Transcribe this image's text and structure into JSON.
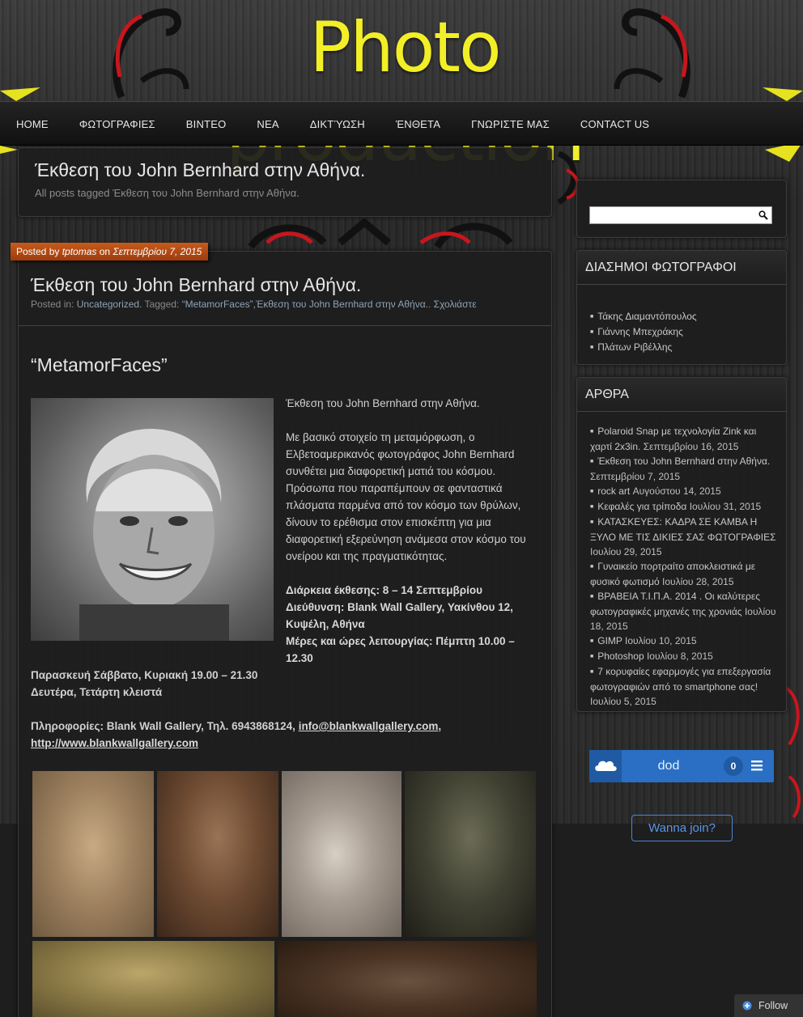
{
  "header": {
    "title": "Photo production"
  },
  "nav": {
    "items": [
      "HOME",
      "ΦΩΤΟΓΡΑΦΙΕΣ",
      "ΒΙΝΤΕΟ",
      "ΝΕΑ",
      "ΔΙΚΤΎΩΣΗ",
      "ΈΝΘΕΤΑ",
      "ΓΝΩΡΙΣΤΕ ΜΑΣ",
      "CONTACT US"
    ]
  },
  "archive": {
    "title": "Έκθεση του John Bernhard στην Αθήνα.",
    "description": "All posts tagged Έκθεση του John Bernhard στην Αθήνα."
  },
  "post": {
    "date_tag": {
      "prefix": "Posted by",
      "author": "tptomas",
      "on": "on",
      "date": "Σεπτεμβρίου 7, 2015"
    },
    "title": "Έκθεση του John Bernhard στην Αθήνα.",
    "meta": {
      "posted_in": "Posted in:",
      "category": "Uncategorized",
      "tagged": ". Tagged:",
      "tags": "“MetamorFaces”,Έκθεση του John Bernhard στην Αθήνα.",
      "sep": ".",
      "comment": "Σχολιάστε"
    },
    "heading": "“MetamorFaces”",
    "paragraphs": [
      "Έκθεση του John Bernhard στην Αθήνα.",
      "Με βασικό στοιχείο τη μεταμόρφωση, ο Ελβετοαμερικανός φωτογράφος John Bernhard συνθέτει μια διαφορετική ματιά του κόσμου. Πρόσωπα που παραπέμπουν σε φανταστικά πλάσματα παρμένα από τον κόσμο των θρύλων, δίνουν το ερέθισμα στον επισκέπτη για μια διαφορετική εξερεύνηση ανάμεσα στον κόσμο του ονείρου και της πραγματικότητας."
    ],
    "details": {
      "duration": "Διάρκεια έκθεσης: 8 – 14 Σεπτεμβρίου",
      "address": "Διεύθυνση: Blank Wall Gallery, Υακίνθου 12, Κυψέλη, Αθήνα",
      "hours": "Μέρες και ώρες λειτουργίας: Πέμπτη 10.00 – 12.30",
      "hours2": "Παρασκευή Σάββατο, Κυριακή 19.00 – 21.30",
      "closed": "Δευτέρα, Τετάρτη κλειστά",
      "info_prefix": "Πληροφορίες: Blank Wall Gallery, Τηλ. 6943868124,",
      "email": "info@blankwallgallery.com",
      "comma": ",",
      "url": "http://www.blankwallgallery.com"
    }
  },
  "sidebar": {
    "search": {
      "placeholder": "",
      "value": ""
    },
    "famous": {
      "title": "ΔΙΑΣΗΜΟΙ ΦΩΤΟΓΡΑΦΟΙ",
      "items": [
        "Τάκης Διαμαντόπουλος",
        "Γιάννης Μπεχράκης",
        "Πλάτων Ριβέλλης"
      ]
    },
    "articles": {
      "title": "ΑΡΘΡΑ",
      "items": [
        {
          "title": "Polaroid Snap με τεχνολογία Zink και χαρτί 2x3in.",
          "date": "Σεπτεμβρίου 16, 2015"
        },
        {
          "title": "Έκθεση του John Bernhard στην Αθήνα.",
          "date": "Σεπτεμβρίου 7, 2015"
        },
        {
          "title": "rock art",
          "date": "Αυγούστου 14, 2015"
        },
        {
          "title": "Κεφαλές για τρίποδα",
          "date": "Ιουλίου 31, 2015"
        },
        {
          "title": "ΚΑΤΑΣΚΕΥΕΣ: ΚΑΔΡΑ ΣΕ ΚΑΜΒΑ Η ΞΥΛΟ ΜΕ ΤΙΣ ΔΙΚΙΕΣ ΣΑΣ ΦΩΤΟΓΡΑΦΙΕΣ",
          "date": "Ιουλίου 29, 2015"
        },
        {
          "title": "Γυναικείο πορτραίτο αποκλειστικά με φυσικό φωτισμό",
          "date": "Ιουλίου 28, 2015"
        },
        {
          "title": "ΒΡΑΒΕΙΑ Τ.Ι.Π.Α. 2014 . Οι καλύτερες φωτογραφικές μηχανές της χρονιάς",
          "date": "Ιουλίου 18, 2015"
        },
        {
          "title": "GIMP",
          "date": "Ιουλίου 10, 2015"
        },
        {
          "title": "Photoshop",
          "date": "Ιουλίου 8, 2015"
        },
        {
          "title": "7 κορυφαίες εφαρμογές για επεξεργασία φωτογραφιών από το smartphone σας!",
          "date": "Ιουλίου 5, 2015"
        }
      ]
    },
    "follow_widget": {
      "name": "dod",
      "count": "0",
      "join_label": "Wanna join?"
    }
  },
  "footer": {
    "follow_label": "Follow"
  },
  "colors": {
    "title_yellow": "#f2ef27",
    "date_tag": "#b84a14",
    "follow_blue": "#2a6fc3",
    "decor_red": "#c8161d"
  }
}
